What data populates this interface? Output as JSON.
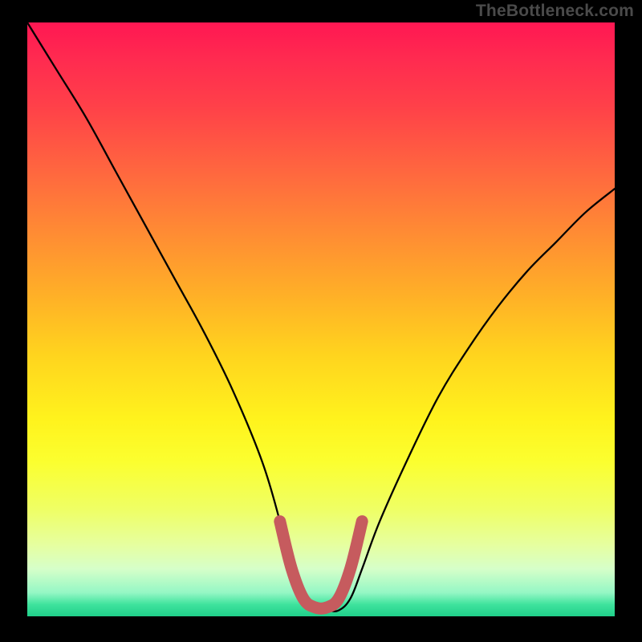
{
  "watermark": "TheBottleneck.com",
  "chart_data": {
    "type": "line",
    "title": "",
    "xlabel": "",
    "ylabel": "",
    "xlim": [
      0,
      100
    ],
    "ylim": [
      0,
      100
    ],
    "series": [
      {
        "name": "bottleneck-curve",
        "x": [
          0,
          5,
          10,
          15,
          20,
          25,
          30,
          35,
          40,
          43,
          45,
          47,
          49,
          51,
          53,
          55,
          57,
          60,
          65,
          70,
          75,
          80,
          85,
          90,
          95,
          100
        ],
        "values": [
          100,
          92,
          84,
          75,
          66,
          57,
          48,
          38,
          26,
          16,
          8,
          3,
          1,
          1,
          1,
          3,
          8,
          16,
          27,
          37,
          45,
          52,
          58,
          63,
          68,
          72
        ]
      }
    ],
    "highlight": {
      "name": "bottom-flat-band",
      "color": "#c65b5e",
      "x": [
        43,
        45,
        47,
        49,
        51,
        53,
        55,
        57
      ],
      "values": [
        16,
        8,
        3,
        1,
        1,
        3,
        8,
        16
      ]
    },
    "gradient_stops": [
      {
        "pos": 0,
        "color": "#ff1752"
      },
      {
        "pos": 14,
        "color": "#ff4049"
      },
      {
        "pos": 35,
        "color": "#ff8a34"
      },
      {
        "pos": 56,
        "color": "#ffd41e"
      },
      {
        "pos": 74,
        "color": "#fbff2f"
      },
      {
        "pos": 92,
        "color": "#d6ffc9"
      },
      {
        "pos": 100,
        "color": "#1fcf8a"
      }
    ]
  }
}
